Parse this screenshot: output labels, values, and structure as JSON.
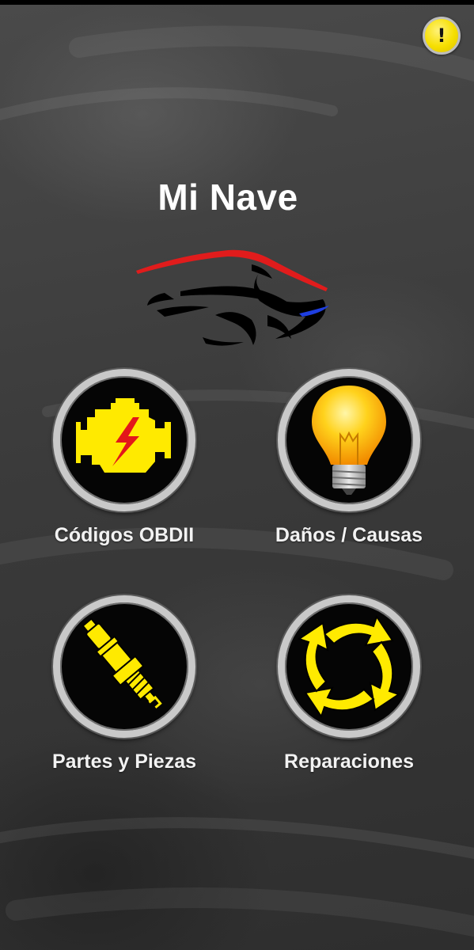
{
  "app": {
    "title": "Mi Nave"
  },
  "alert_button": {
    "symbol": "!",
    "icon": "exclamation-icon",
    "color": "#f6df00"
  },
  "logo": {
    "icon": "car-silhouette-logo",
    "colors": {
      "roof": "#e01c1c",
      "headlight": "#1e3ee0",
      "body": "#000000"
    }
  },
  "menu": {
    "items": [
      {
        "label": "Códigos OBDII",
        "icon": "check-engine-icon"
      },
      {
        "label": "Daños / Causas",
        "icon": "light-bulb-icon"
      },
      {
        "label": "Partes y Piezas",
        "icon": "spark-plug-icon"
      },
      {
        "label": "Reparaciones",
        "icon": "circular-arrows-icon"
      }
    ]
  },
  "colors": {
    "accent_yellow": "#ffea00",
    "lightning_red": "#e3171a",
    "background": "#3f3f3f",
    "text": "#ffffff"
  }
}
